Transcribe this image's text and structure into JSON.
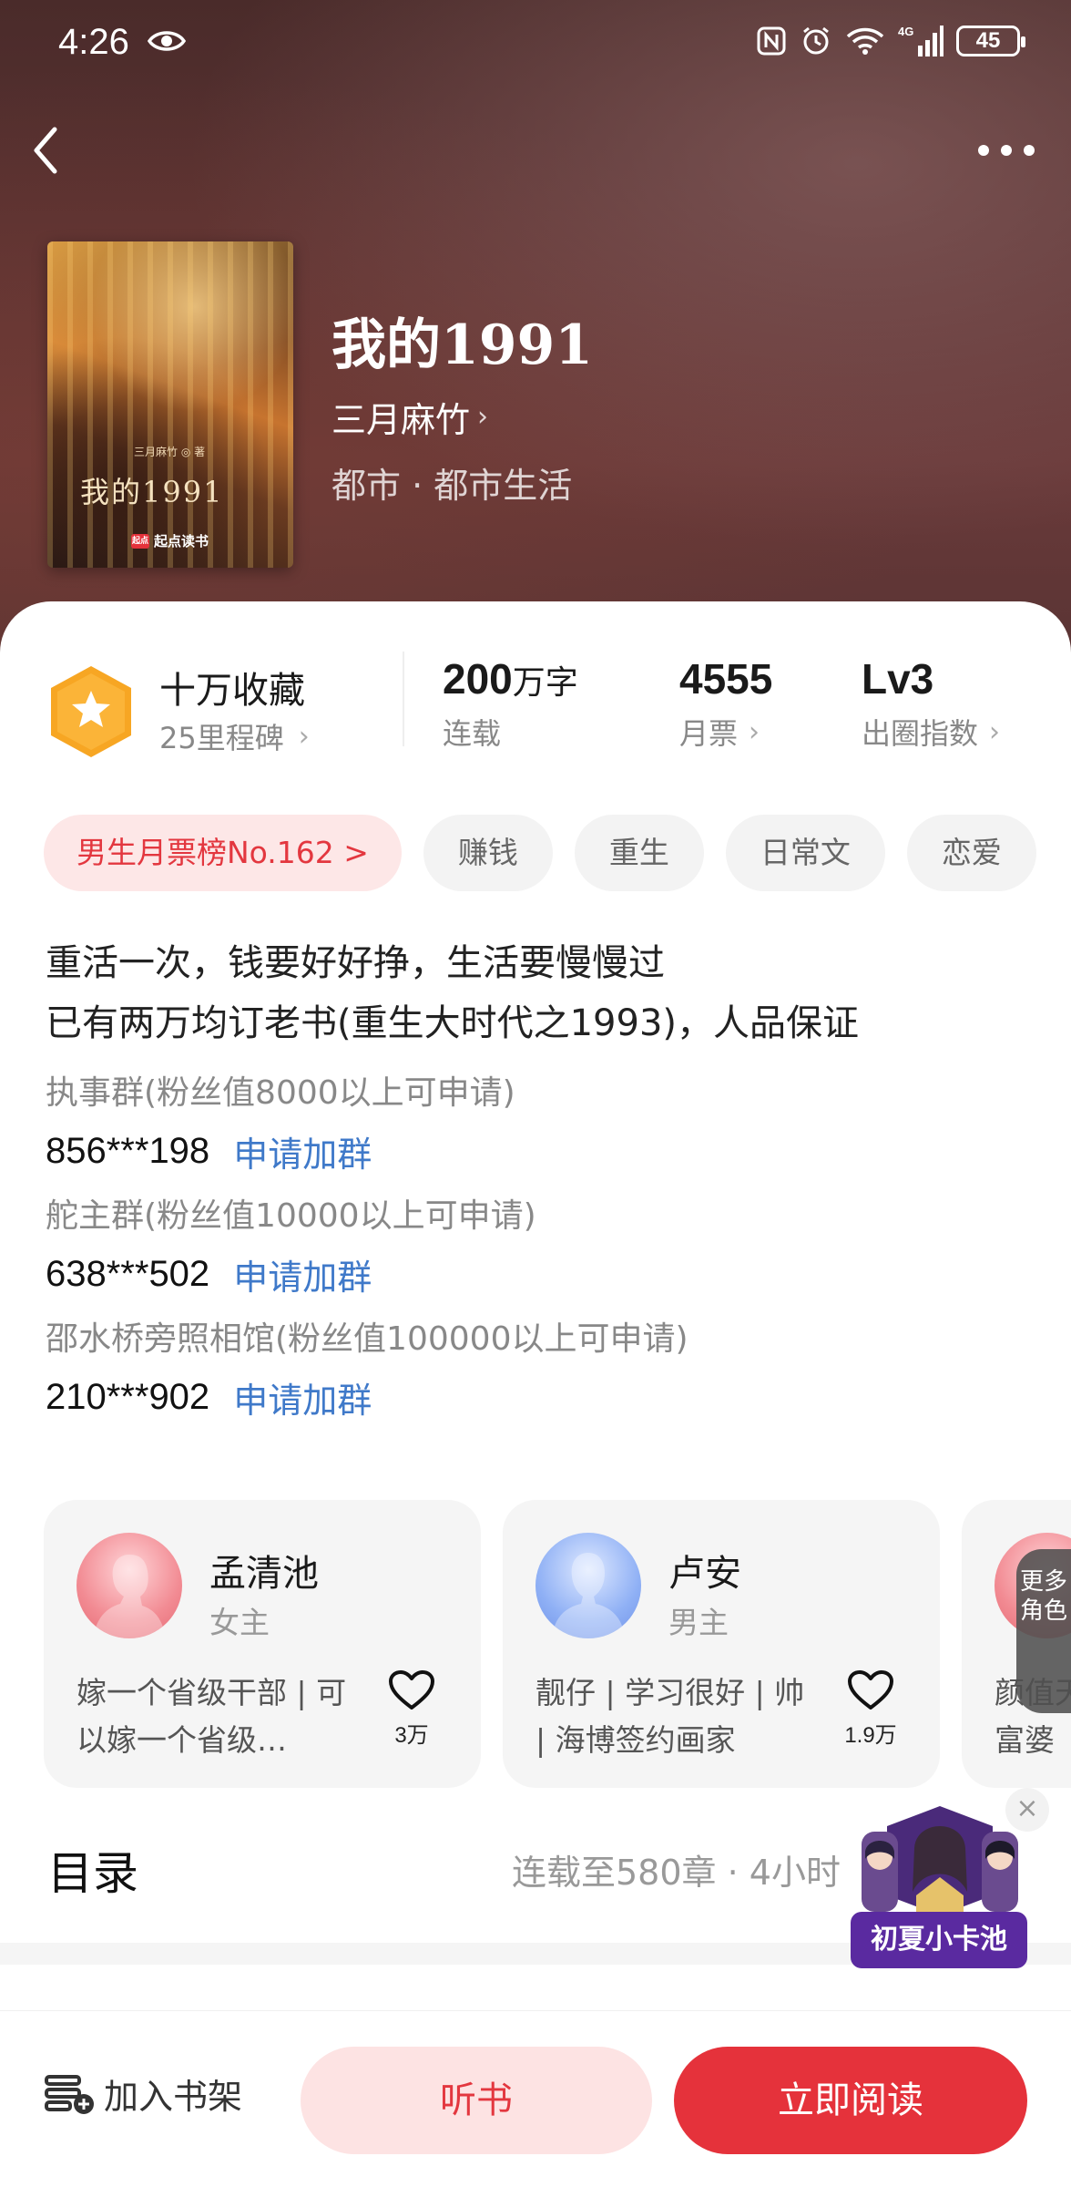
{
  "status_bar": {
    "time": "4:26",
    "battery": "45",
    "signal": "4G"
  },
  "book": {
    "title": "我的1991",
    "author": "三月麻竹",
    "genre": "都市 · 都市生活",
    "cover_author": "三月麻竹 ◎ 著",
    "cover_title": "我的1991",
    "cover_logo_mark": "起点",
    "cover_logo": "起点读书"
  },
  "stats": {
    "collect_main": "十万收藏",
    "collect_sub": "25里程碑",
    "words_value": "200",
    "words_unit": "万字",
    "words_label": "连载",
    "tickets_value": "4555",
    "tickets_label": "月票",
    "level_value": "Lv3",
    "level_label": "出圈指数"
  },
  "tags": [
    "男生月票榜No.162 >",
    "赚钱",
    "重生",
    "日常文",
    "恋爱"
  ],
  "intro": {
    "lines": [
      "重活一次，钱要好好挣，生活要慢慢过",
      "已有两万均订老书(重生大时代之1993)，人品保证"
    ],
    "groups": [
      {
        "title": "执事群(粉丝值8000以上可申请)",
        "id": "856***198",
        "join": "申请加群"
      },
      {
        "title": "舵主群(粉丝值10000以上可申请)",
        "id": "638***502",
        "join": "申请加群"
      },
      {
        "title": "邵水桥旁照相馆(粉丝值100000以上可申请)",
        "id": "210***902",
        "join": "申请加群"
      }
    ]
  },
  "characters": [
    {
      "name": "孟清池",
      "role": "女主",
      "desc": "嫁一个省级干部 | 可以嫁一个省级…",
      "likes": "3万"
    },
    {
      "name": "卢安",
      "role": "男主",
      "desc": "靓仔 | 学习很好 | 帅 | 海博签约画家",
      "likes": "1.9万"
    },
    {
      "name": "",
      "role": "",
      "desc": "颜值天 富婆",
      "likes": ""
    }
  ],
  "more_roles": "更多角色",
  "toc": {
    "title": "目录",
    "info": "连载至580章 · 4小时"
  },
  "promo": {
    "label": "初夏小卡池",
    "close": "×"
  },
  "bottom": {
    "shelf": "加入书架",
    "listen": "听书",
    "read": "立即阅读"
  },
  "colors": {
    "accent": "#e5323b",
    "link": "#3f79c9",
    "badge": "#f5a623"
  }
}
